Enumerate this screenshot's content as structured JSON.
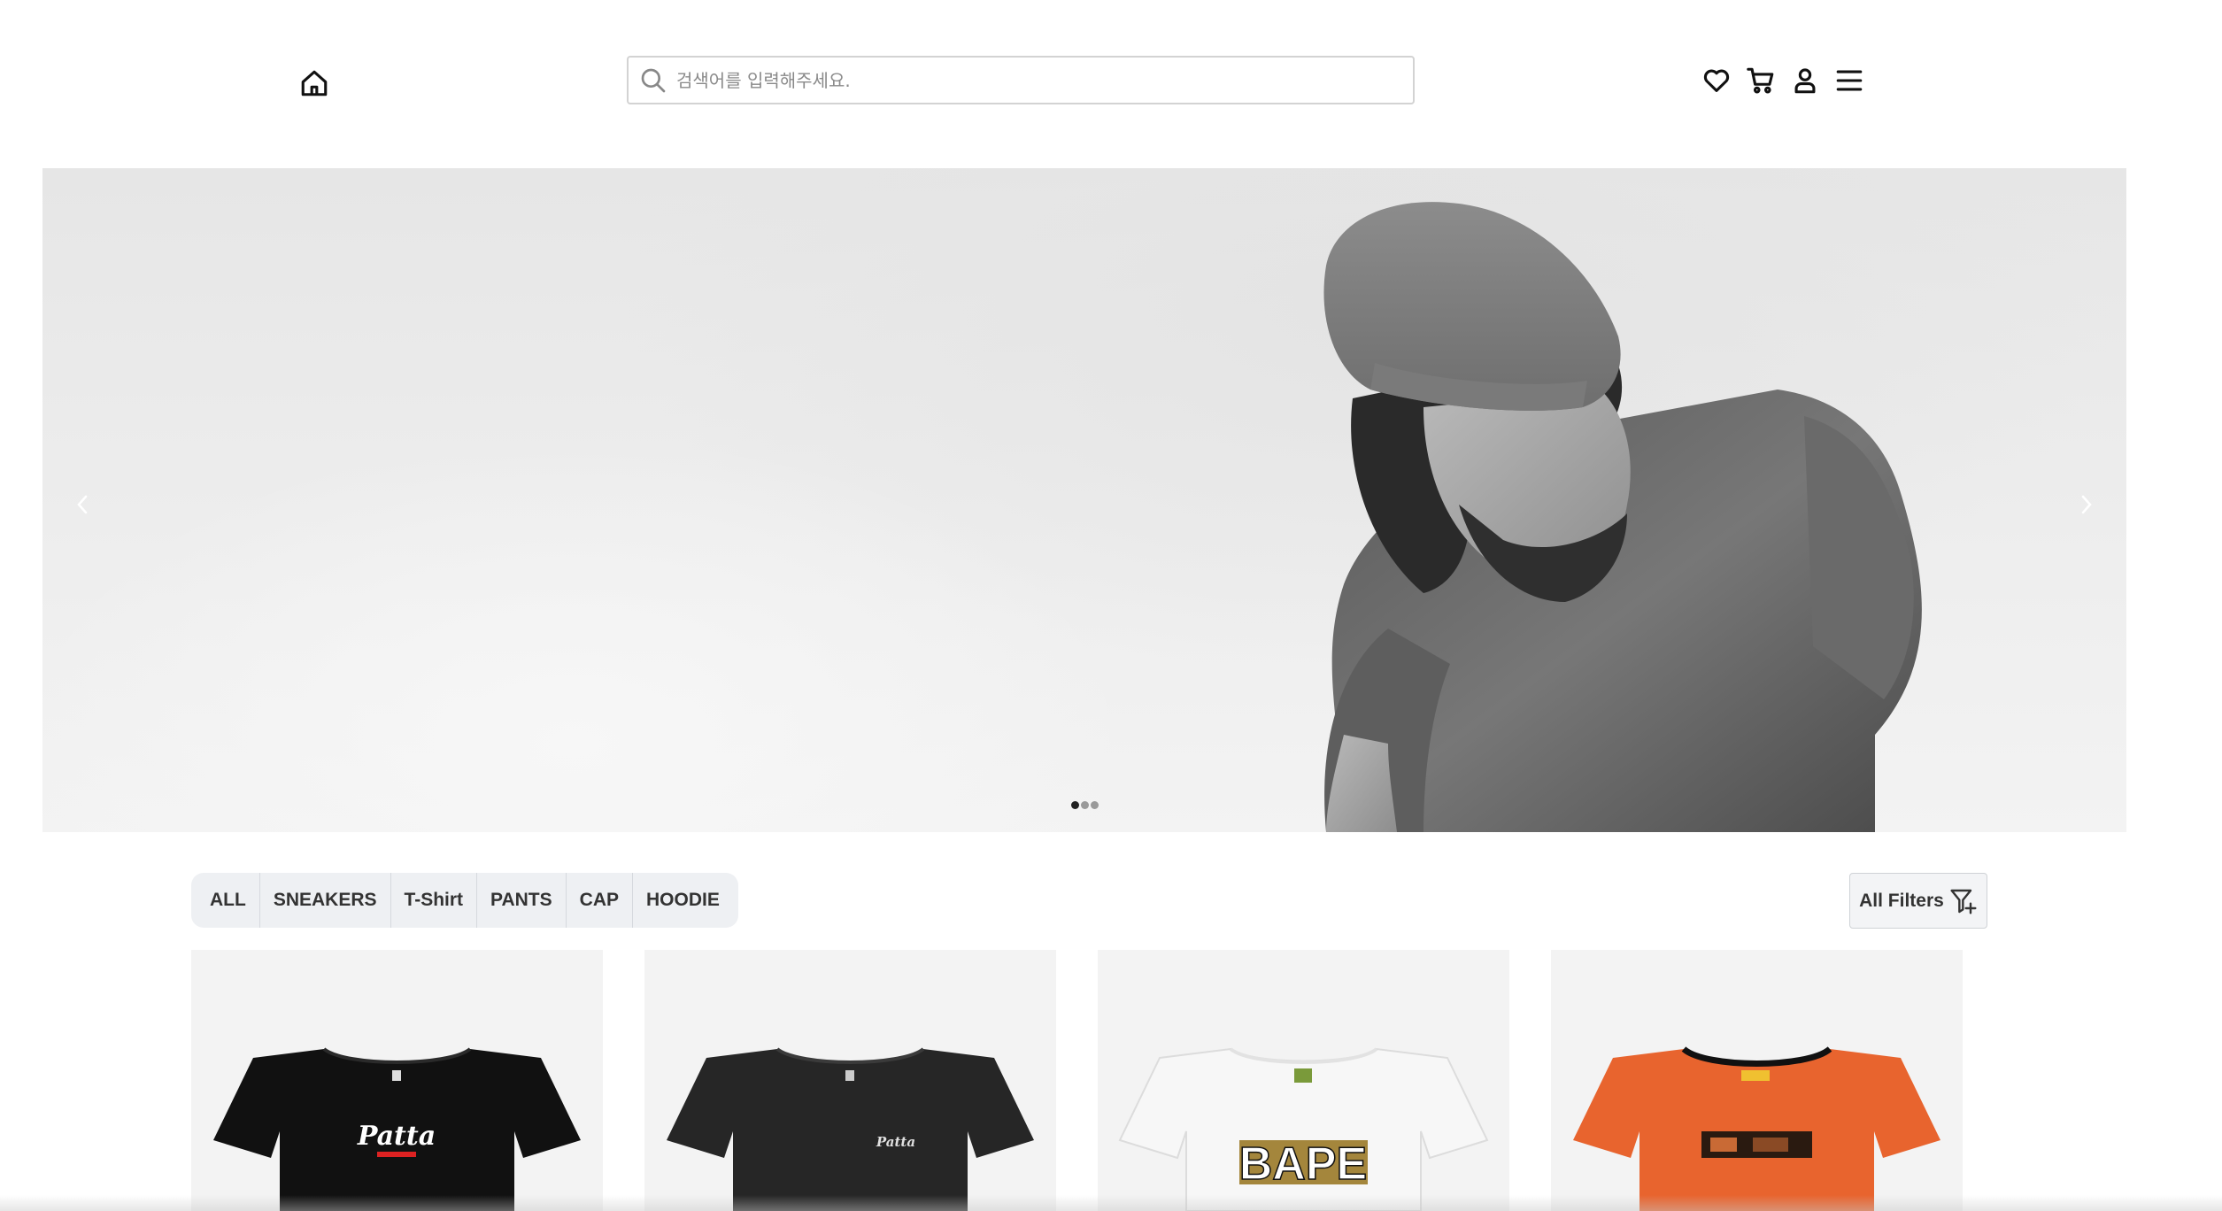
{
  "header": {
    "home_icon": "home-icon",
    "search": {
      "placeholder": "검색어를 입력해주세요.",
      "value": "",
      "icon": "search-icon"
    },
    "icons": [
      "heart-icon",
      "cart-icon",
      "user-icon",
      "menu-icon"
    ]
  },
  "hero": {
    "prev_icon": "chevron-left-icon",
    "next_icon": "chevron-right-icon",
    "slide_count": 3,
    "active_slide": 1
  },
  "categories": {
    "items": [
      {
        "label": "ALL"
      },
      {
        "label": "SNEAKERS"
      },
      {
        "label": "T-Shirt"
      },
      {
        "label": "PANTS"
      },
      {
        "label": "CAP"
      },
      {
        "label": "HOODIE"
      }
    ],
    "all_filters_label": "All Filters",
    "filter_icon": "filter-add-icon"
  },
  "products": [
    {
      "image": "black-tshirt",
      "logo_text": "Patta"
    },
    {
      "image": "charcoal-tshirt",
      "logo_text": "Patta"
    },
    {
      "image": "white-tshirt",
      "logo_text": "BAPE"
    },
    {
      "image": "orange-tshirt",
      "logo_text": ""
    }
  ],
  "colors": {
    "category_bg": "#eef0f3",
    "search_border": "#d3d3d3",
    "product_bg": "#f3f3f3"
  }
}
